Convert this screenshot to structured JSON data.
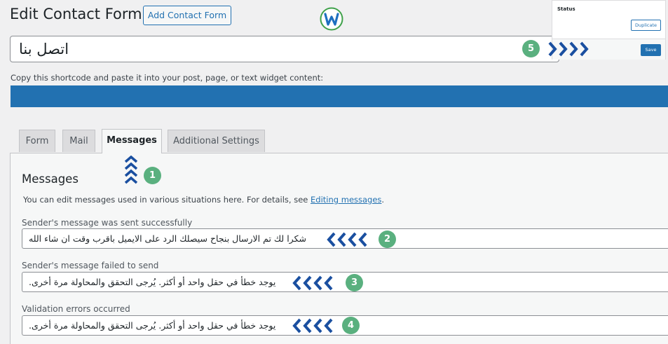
{
  "header": {
    "title": "Edit Contact Form",
    "add_button": "Add Contact Form"
  },
  "form_title_value": "اتصل بنا",
  "status_box": {
    "title": "Status",
    "duplicate": "Duplicate",
    "save": "Save"
  },
  "shortcode_hint": "Copy this shortcode and paste it into your post, page, or text widget content:",
  "tabs": [
    {
      "label": "Form"
    },
    {
      "label": "Mail"
    },
    {
      "label": "Messages"
    },
    {
      "label": "Additional Settings"
    }
  ],
  "active_tab": "Messages",
  "messages": {
    "heading": "Messages",
    "description": "You can edit messages used in various situations here. For details, see",
    "link_text": "Editing messages",
    "description_end": ".",
    "fields": [
      {
        "label": "Sender's message was sent successfully",
        "value": "شكرا لك تم الارسال بنجاح سيصلك الرد على الايميل باقرب وقت ان شاء الله"
      },
      {
        "label": "Sender's message failed to send",
        "value": "يوجد خطأ في حقل واحد أو أكثر. يُرجى التحقق والمحاولة مرة أخرى."
      },
      {
        "label": "Validation errors occurred",
        "value": "يوجد خطأ في حقل واحد أو أكثر. يُرجى التحقق والمحاولة مرة أخرى."
      }
    ]
  },
  "annotations": [
    "1",
    "2",
    "3",
    "4",
    "5"
  ],
  "colors": {
    "accent": "#2271b1",
    "badge": "#5ab07f",
    "arrow": "#1a4fa0"
  }
}
